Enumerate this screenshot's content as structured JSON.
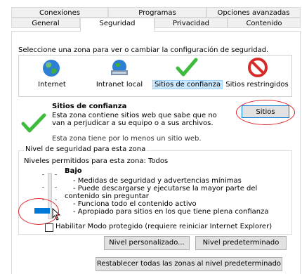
{
  "tabs_top": [
    "Conexiones",
    "Programas",
    "Opciones avanzadas"
  ],
  "tabs_bottom": [
    "General",
    "Seguridad",
    "Privacidad",
    "Contenido"
  ],
  "instruction": "Seleccione una zona para ver o cambiar la configuración de seguridad.",
  "zones": [
    {
      "label": "Internet",
      "icon": "globe-icon"
    },
    {
      "label": "Intranet local",
      "icon": "intranet-icon"
    },
    {
      "label": "Sitios de confianza",
      "icon": "checkmark-icon"
    },
    {
      "label": "Sitios restringidos",
      "icon": "no-entry-icon"
    }
  ],
  "selected_zone": {
    "title": "Sitios de confianza",
    "description_line1": "Esta zona contiene sitios web que sabe que no",
    "description_line2": "van a perjudicar a su equipo o a sus archivos.",
    "note": "Esta zona tiene por lo menos un sitio web.",
    "sites_button": "Sitios"
  },
  "security_level": {
    "group_label": "Nivel de seguridad para esta zona",
    "allowed_levels": "Niveles permitidos para esta zona: Todos",
    "level_name": "Bajo",
    "bullets": [
      "- Medidas de seguridad y advertencias mínimas",
      "- Puede descargarse y ejecutarse la mayor parte del",
      "contenido sin preguntar",
      "- Funciona todo el contenido activo",
      "- Apropiado para sitios en los que tiene plena confianza"
    ]
  },
  "protected_mode_label": "Habilitar Modo protegido (requiere reiniciar Internet Explorer)",
  "protected_mode_checked": false,
  "custom_level_button": "Nivel personalizado...",
  "default_level_button": "Nivel predeterminado",
  "reset_all_button": "Restablecer todas las zonas al nivel predeterminado",
  "colors": {
    "accent": "#0078d7",
    "annotation": "#e0282e",
    "check": "#3dbb3d"
  }
}
